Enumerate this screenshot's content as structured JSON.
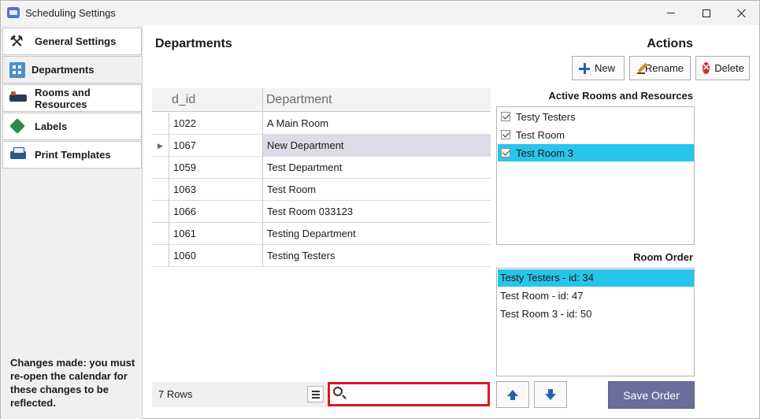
{
  "window": {
    "title": "Scheduling Settings"
  },
  "sidebar": {
    "items": [
      {
        "label": "General Settings",
        "icon": "tools-icon"
      },
      {
        "label": "Departments",
        "icon": "building-icon",
        "selected": true
      },
      {
        "label": "Rooms and Resources",
        "icon": "bed-icon"
      },
      {
        "label": "Labels",
        "icon": "tag-icon"
      },
      {
        "label": "Print Templates",
        "icon": "printer-icon"
      }
    ],
    "note": "Changes made: you must re-open the calendar for these changes to be reflected."
  },
  "departments": {
    "heading": "Departments",
    "columns": [
      "d_id",
      "Department"
    ],
    "rows": [
      {
        "id": "1022",
        "name": "A Main Room"
      },
      {
        "id": "1067",
        "name": "New Department",
        "selected": true
      },
      {
        "id": "1059",
        "name": "Test Department"
      },
      {
        "id": "1063",
        "name": "Test Room"
      },
      {
        "id": "1066",
        "name": "Test Room 033123"
      },
      {
        "id": "1061",
        "name": "Testing Department"
      },
      {
        "id": "1060",
        "name": "Testing Testers"
      }
    ],
    "row_count": "7 Rows",
    "search": {
      "value": "",
      "placeholder": ""
    }
  },
  "actions": {
    "heading": "Actions",
    "new_label": "New",
    "rename_label": "Rename",
    "delete_label": "Delete",
    "active_label": "Active Rooms and Resources",
    "active_items": [
      {
        "label": "Testy Testers",
        "checked": true
      },
      {
        "label": "Test Room",
        "checked": true
      },
      {
        "label": "Test Room 3",
        "checked": true,
        "selected": true
      }
    ],
    "order_label": "Room Order",
    "order_items": [
      {
        "label": "Testy Testers - id: 34",
        "selected": true
      },
      {
        "label": "Test Room - id: 47"
      },
      {
        "label": "Test Room 3 - id: 50"
      }
    ],
    "save_label": "Save Order"
  },
  "colors": {
    "selection_blue": "#29c4ea",
    "grid_selected": "#dcdce6",
    "save_button": "#6b6e9a",
    "search_highlight": "#e0151f"
  }
}
